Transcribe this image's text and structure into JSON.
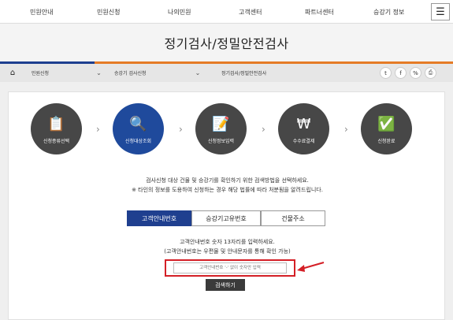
{
  "topnav": {
    "items": [
      "민원안내",
      "민원신청",
      "나의민원",
      "고객센터",
      "파트너센터",
      "승강기 정보"
    ],
    "menu_icon": "hamburger-menu-icon"
  },
  "page": {
    "title": "정기검사/정밀안전검사"
  },
  "breadcrumb": {
    "home_icon": "home-icon",
    "items": [
      "민원신청",
      "승강기 검사신청",
      "정기검사/정밀안전검사"
    ],
    "share_icons": [
      "twitter-icon",
      "facebook-icon",
      "link-icon",
      "print-icon"
    ]
  },
  "steps": [
    {
      "label": "신청종류선택",
      "icon": "clipboard-icon"
    },
    {
      "label": "신청대상조회",
      "icon": "document-search-icon",
      "active": true
    },
    {
      "label": "신청정보입력",
      "icon": "document-edit-icon"
    },
    {
      "label": "수수료결제",
      "icon": "won-coin-icon"
    },
    {
      "label": "신청완료",
      "icon": "clipboard-check-icon"
    }
  ],
  "description": {
    "line1": "검사신청 대상 건물 및 승강기를 확인하기 위한 검색방법을 선택하세요.",
    "line2": "※ 타인의 정보를 도용하여 신청하는 경우 해당 법률에 따라 처분됨을 알려드립니다."
  },
  "search_tabs": [
    {
      "label": "고객안내번호",
      "active": true
    },
    {
      "label": "승강기고유번호"
    },
    {
      "label": "건물주소"
    }
  ],
  "hint": {
    "line1": "고객안내번호 숫자 13자리를 입력하세요.",
    "line2": "(고객안내번호는 우편물 및 안내문자를 통해 확인 가능)"
  },
  "input": {
    "placeholder": "고객안내번호 '-' 없이 숫자만 입력"
  },
  "search_button": {
    "label": "검색하기"
  },
  "colors": {
    "primary": "#1f4a9c",
    "accent_orange": "#e57b26",
    "highlight_red": "#d41f26"
  }
}
